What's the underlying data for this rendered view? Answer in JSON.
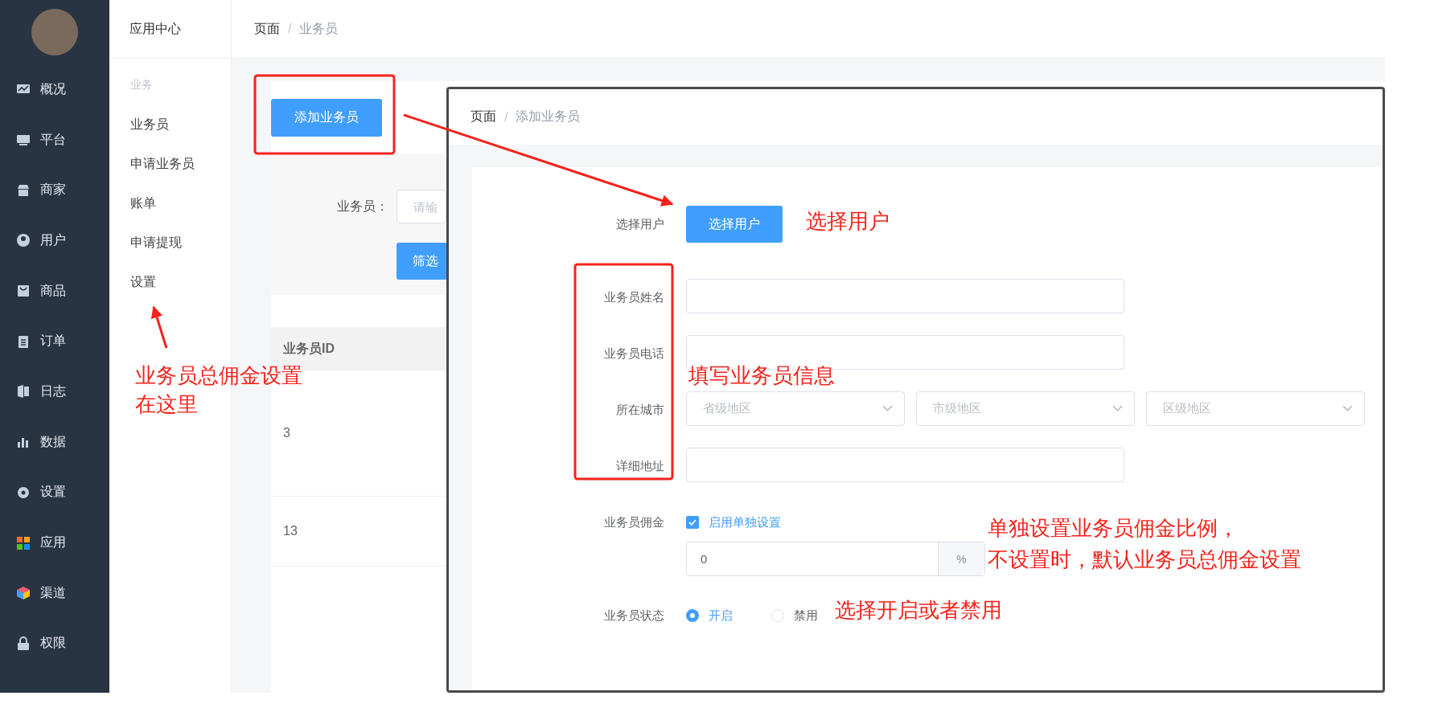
{
  "sidebar": {
    "items": [
      {
        "label": "概况"
      },
      {
        "label": "平台"
      },
      {
        "label": "商家"
      },
      {
        "label": "用户"
      },
      {
        "label": "商品"
      },
      {
        "label": "订单"
      },
      {
        "label": "日志"
      },
      {
        "label": "数据"
      },
      {
        "label": "设置"
      },
      {
        "label": "应用"
      },
      {
        "label": "渠道"
      },
      {
        "label": "权限"
      }
    ]
  },
  "app_panel": {
    "title": "应用中心",
    "section": "业务",
    "items": [
      "业务员",
      "申请业务员",
      "账单",
      "申请提现",
      "设置"
    ]
  },
  "breadcrumb": {
    "items": [
      "页面",
      "业务员"
    ],
    "separator": "/"
  },
  "add_button": "添加业务员",
  "filter": {
    "label": "业务员：",
    "placeholder": "请输",
    "button": "筛选"
  },
  "table": {
    "columns": [
      "业务员ID"
    ],
    "rows": [
      [
        "3"
      ],
      [
        "13"
      ]
    ]
  },
  "dialog": {
    "breadcrumb": {
      "items": [
        "页面",
        "添加业务员"
      ],
      "separator": "/"
    },
    "fields": [
      {
        "kind": "button",
        "label": "选择用户",
        "button": "选择用户"
      },
      {
        "kind": "text",
        "label": "业务员姓名"
      },
      {
        "kind": "text",
        "label": "业务员电话"
      },
      {
        "kind": "selects",
        "label": "所在城市",
        "placeholders": [
          "省级地区",
          "市级地区",
          "区级地区"
        ]
      },
      {
        "kind": "text",
        "label": "详细地址"
      },
      {
        "kind": "commission",
        "label": "业务员佣金",
        "checkbox": {
          "label": "启用单独设置",
          "checked": true
        },
        "value": "0",
        "unit": "%"
      },
      {
        "kind": "radio",
        "label": "业务员状态",
        "options": [
          {
            "label": "开启",
            "selected": true
          },
          {
            "label": "禁用",
            "selected": false
          }
        ]
      }
    ]
  },
  "annotations": [
    "业务员总佣金设置",
    "在这里",
    "选择用户",
    "填写业务员信息",
    "单独设置业务员佣金比例，",
    "不设置时，默认业务员总佣金设置",
    "选择开启或者禁用"
  ]
}
